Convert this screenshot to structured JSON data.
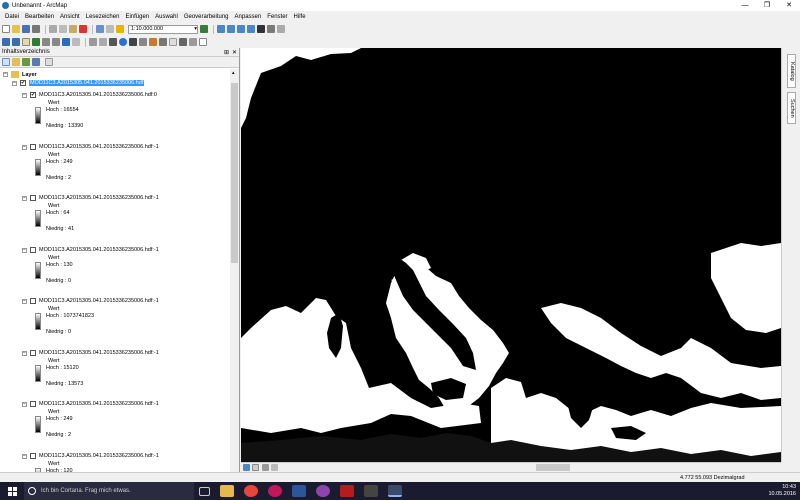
{
  "window": {
    "title": "Unbenannt - ArcMap",
    "min": "—",
    "max": "❐",
    "close": "✕"
  },
  "menu": [
    "Datei",
    "Bearbeiten",
    "Ansicht",
    "Lesezeichen",
    "Einfügen",
    "Auswahl",
    "Geoverarbeitung",
    "Anpassen",
    "Fenster",
    "Hilfe"
  ],
  "toolbar": {
    "scale": "1:10.000.000"
  },
  "toc": {
    "title": "Inhaltsverzeichnis",
    "pin": "⊞",
    "close": "✕",
    "root": "Layer",
    "group": "MOD11C3.A2015305.041.2015336235006.hdf",
    "items": [
      {
        "name": "MOD11C3.A2015305.041.2015336235006.hdf:0",
        "wert": "Wert",
        "hoch": "Hoch : 16554",
        "niedrig": "Niedrig : 13390",
        "checked": "✔"
      },
      {
        "name": "MOD11C3.A2015305.041.2015336235006.hdf:-1",
        "wert": "Wert",
        "hoch": "Hoch : 249",
        "niedrig": "Niedrig : 2",
        "checked": ""
      },
      {
        "name": "MOD11C3.A2015305.041.2015336235006.hdf:-1",
        "wert": "Wert",
        "hoch": "Hoch : 64",
        "niedrig": "Niedrig : 41",
        "checked": ""
      },
      {
        "name": "MOD11C3.A2015305.041.2015336235006.hdf:-1",
        "wert": "Wert",
        "hoch": "Hoch : 130",
        "niedrig": "Niedrig : 0",
        "checked": ""
      },
      {
        "name": "MOD11C3.A2015305.041.2015336235006.hdf:-1",
        "wert": "Wert",
        "hoch": "Hoch : 1073741823",
        "niedrig": "Niedrig : 0",
        "checked": ""
      },
      {
        "name": "MOD11C3.A2015305.041.2015336235006.hdf:-1",
        "wert": "Wert",
        "hoch": "Hoch : 15120",
        "niedrig": "Niedrig : 13573",
        "checked": ""
      },
      {
        "name": "MOD11C3.A2015305.041.2015336235006.hdf:-1",
        "wert": "Wert",
        "hoch": "Hoch : 249",
        "niedrig": "Niedrig : 2",
        "checked": ""
      },
      {
        "name": "MOD11C3.A2015305.041.2015336235006.hdf:-1",
        "wert": "Wert",
        "hoch": "Hoch : 120",
        "niedrig": "",
        "checked": ""
      }
    ]
  },
  "side_tabs": {
    "catalog": "Katalog",
    "search": "Suchen"
  },
  "status": {
    "coords": "4.772  55.093 Dezimalgrad"
  },
  "taskbar": {
    "search": "Ich bin Cortana. Frag mich etwas.",
    "time": "10:43",
    "date": "10.05.2016"
  },
  "colors": {
    "taskbar": "#1b1b2f",
    "selection": "#3399ff",
    "map_land": "#000000",
    "map_cloud": "#ffffff"
  }
}
